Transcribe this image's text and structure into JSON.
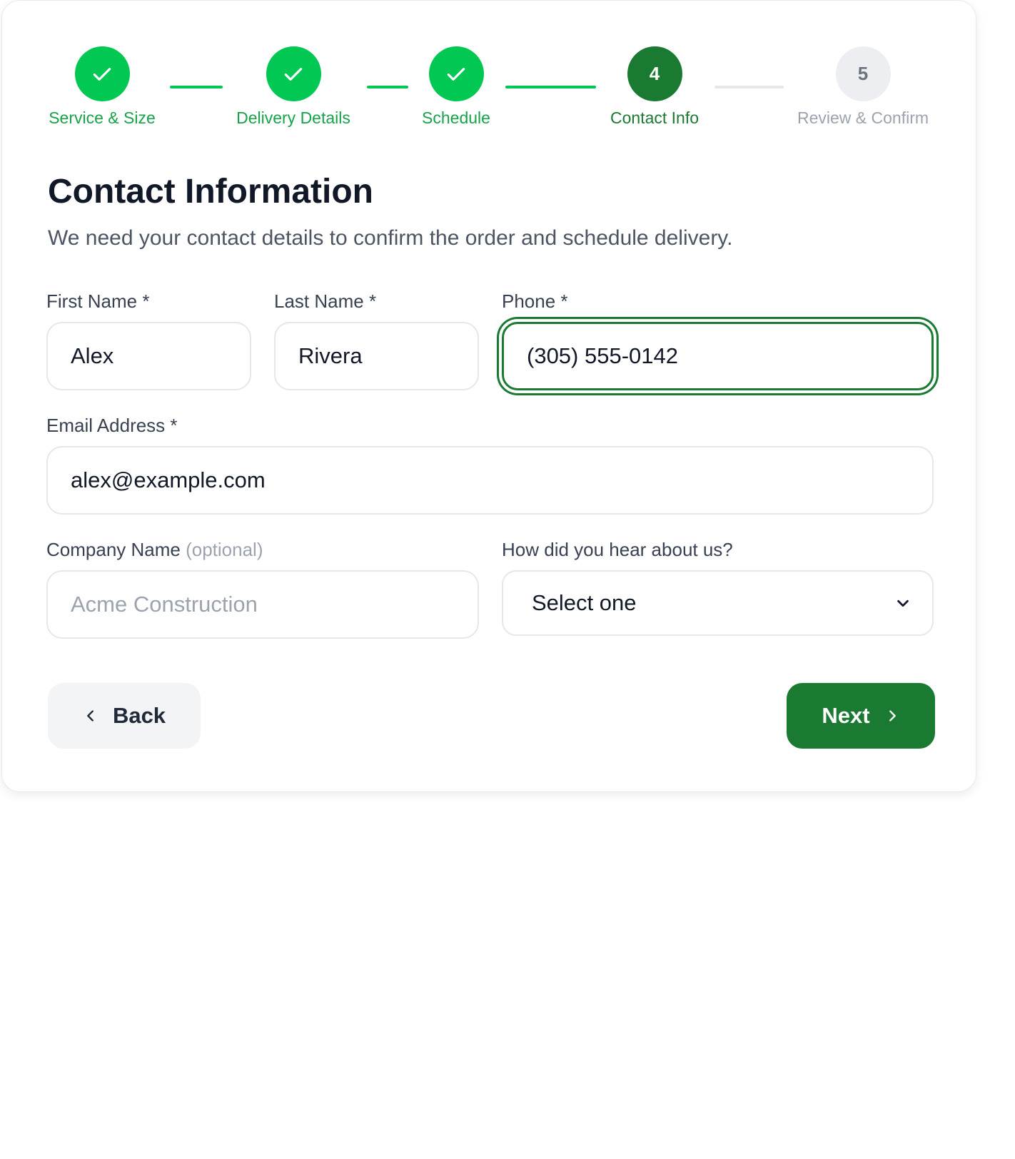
{
  "stepper": {
    "steps": [
      {
        "label": "Service & Size",
        "state": "done",
        "number": ""
      },
      {
        "label": "Delivery Details",
        "state": "done",
        "number": ""
      },
      {
        "label": "Schedule",
        "state": "done",
        "number": ""
      },
      {
        "label": "Contact Info",
        "state": "current",
        "number": "4"
      },
      {
        "label": "Review & Confirm",
        "state": "todo",
        "number": "5"
      }
    ]
  },
  "page": {
    "title": "Contact Information",
    "subtitle": "We need your contact details to confirm the order and schedule delivery."
  },
  "form": {
    "first_name": {
      "label": "First Name *",
      "value": "Alex"
    },
    "last_name": {
      "label": "Last Name *",
      "value": "Rivera"
    },
    "phone": {
      "label": "Phone *",
      "value": "(305) 555-0142"
    },
    "email": {
      "label": "Email Address *",
      "value": "alex@example.com"
    },
    "company": {
      "label": "Company Name",
      "optional": "(optional)",
      "value": "",
      "placeholder": "Acme Construction"
    },
    "referral": {
      "label": "How did you hear about us?",
      "selected": "Select one"
    }
  },
  "actions": {
    "back_label": "Back",
    "next_label": "Next"
  },
  "colors": {
    "primary": "#1b7a32",
    "done": "#00c853",
    "todo": "#eceef1"
  }
}
